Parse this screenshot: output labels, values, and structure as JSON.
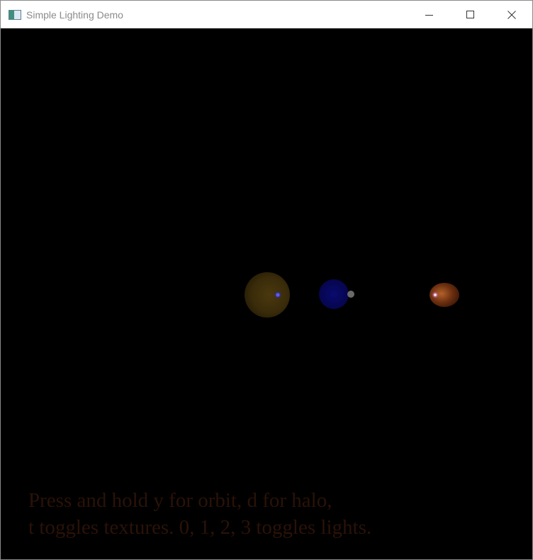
{
  "window": {
    "title": "Simple Lighting Demo",
    "icon": "app-window-icon",
    "buttons": {
      "minimize": "minimize-icon",
      "maximize": "maximize-icon",
      "close": "close-icon"
    }
  },
  "scene": {
    "background_color": "#000000",
    "bodies": [
      {
        "name": "sun",
        "color": "#3a2c0a"
      },
      {
        "name": "blue-planet",
        "color": "#07075e"
      },
      {
        "name": "grey-moon",
        "color": "#6a6a6a"
      },
      {
        "name": "orange-planet",
        "color": "#5a2a0a"
      }
    ]
  },
  "help": {
    "line1": "Press and hold y for orbit, d for halo,",
    "line2": "t toggles textures. 0, 1, 2, 3 toggles lights.",
    "color": "#2a1207"
  }
}
